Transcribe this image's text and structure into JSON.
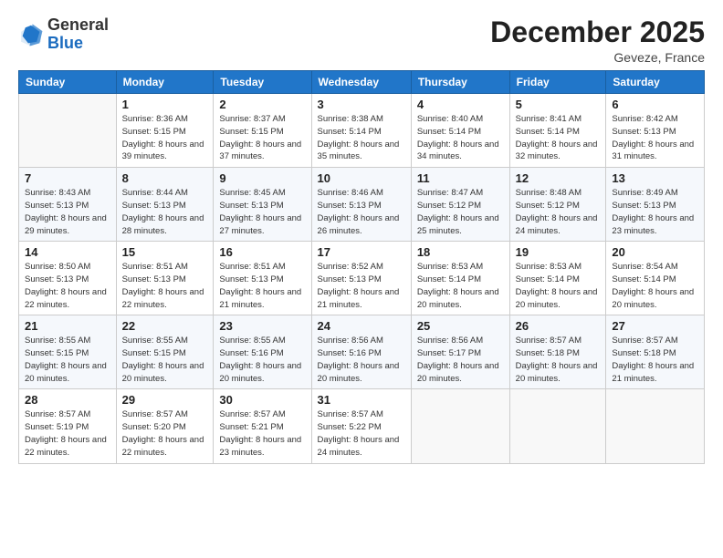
{
  "logo": {
    "general": "General",
    "blue": "Blue"
  },
  "header": {
    "title": "December 2025",
    "subtitle": "Geveze, France"
  },
  "weekdays": [
    "Sunday",
    "Monday",
    "Tuesday",
    "Wednesday",
    "Thursday",
    "Friday",
    "Saturday"
  ],
  "weeks": [
    [
      {
        "day": "",
        "empty": true
      },
      {
        "day": "1",
        "sunrise": "Sunrise: 8:36 AM",
        "sunset": "Sunset: 5:15 PM",
        "daylight": "Daylight: 8 hours and 39 minutes."
      },
      {
        "day": "2",
        "sunrise": "Sunrise: 8:37 AM",
        "sunset": "Sunset: 5:15 PM",
        "daylight": "Daylight: 8 hours and 37 minutes."
      },
      {
        "day": "3",
        "sunrise": "Sunrise: 8:38 AM",
        "sunset": "Sunset: 5:14 PM",
        "daylight": "Daylight: 8 hours and 35 minutes."
      },
      {
        "day": "4",
        "sunrise": "Sunrise: 8:40 AM",
        "sunset": "Sunset: 5:14 PM",
        "daylight": "Daylight: 8 hours and 34 minutes."
      },
      {
        "day": "5",
        "sunrise": "Sunrise: 8:41 AM",
        "sunset": "Sunset: 5:14 PM",
        "daylight": "Daylight: 8 hours and 32 minutes."
      },
      {
        "day": "6",
        "sunrise": "Sunrise: 8:42 AM",
        "sunset": "Sunset: 5:13 PM",
        "daylight": "Daylight: 8 hours and 31 minutes."
      }
    ],
    [
      {
        "day": "7",
        "sunrise": "Sunrise: 8:43 AM",
        "sunset": "Sunset: 5:13 PM",
        "daylight": "Daylight: 8 hours and 29 minutes."
      },
      {
        "day": "8",
        "sunrise": "Sunrise: 8:44 AM",
        "sunset": "Sunset: 5:13 PM",
        "daylight": "Daylight: 8 hours and 28 minutes."
      },
      {
        "day": "9",
        "sunrise": "Sunrise: 8:45 AM",
        "sunset": "Sunset: 5:13 PM",
        "daylight": "Daylight: 8 hours and 27 minutes."
      },
      {
        "day": "10",
        "sunrise": "Sunrise: 8:46 AM",
        "sunset": "Sunset: 5:13 PM",
        "daylight": "Daylight: 8 hours and 26 minutes."
      },
      {
        "day": "11",
        "sunrise": "Sunrise: 8:47 AM",
        "sunset": "Sunset: 5:12 PM",
        "daylight": "Daylight: 8 hours and 25 minutes."
      },
      {
        "day": "12",
        "sunrise": "Sunrise: 8:48 AM",
        "sunset": "Sunset: 5:12 PM",
        "daylight": "Daylight: 8 hours and 24 minutes."
      },
      {
        "day": "13",
        "sunrise": "Sunrise: 8:49 AM",
        "sunset": "Sunset: 5:13 PM",
        "daylight": "Daylight: 8 hours and 23 minutes."
      }
    ],
    [
      {
        "day": "14",
        "sunrise": "Sunrise: 8:50 AM",
        "sunset": "Sunset: 5:13 PM",
        "daylight": "Daylight: 8 hours and 22 minutes."
      },
      {
        "day": "15",
        "sunrise": "Sunrise: 8:51 AM",
        "sunset": "Sunset: 5:13 PM",
        "daylight": "Daylight: 8 hours and 22 minutes."
      },
      {
        "day": "16",
        "sunrise": "Sunrise: 8:51 AM",
        "sunset": "Sunset: 5:13 PM",
        "daylight": "Daylight: 8 hours and 21 minutes."
      },
      {
        "day": "17",
        "sunrise": "Sunrise: 8:52 AM",
        "sunset": "Sunset: 5:13 PM",
        "daylight": "Daylight: 8 hours and 21 minutes."
      },
      {
        "day": "18",
        "sunrise": "Sunrise: 8:53 AM",
        "sunset": "Sunset: 5:14 PM",
        "daylight": "Daylight: 8 hours and 20 minutes."
      },
      {
        "day": "19",
        "sunrise": "Sunrise: 8:53 AM",
        "sunset": "Sunset: 5:14 PM",
        "daylight": "Daylight: 8 hours and 20 minutes."
      },
      {
        "day": "20",
        "sunrise": "Sunrise: 8:54 AM",
        "sunset": "Sunset: 5:14 PM",
        "daylight": "Daylight: 8 hours and 20 minutes."
      }
    ],
    [
      {
        "day": "21",
        "sunrise": "Sunrise: 8:55 AM",
        "sunset": "Sunset: 5:15 PM",
        "daylight": "Daylight: 8 hours and 20 minutes."
      },
      {
        "day": "22",
        "sunrise": "Sunrise: 8:55 AM",
        "sunset": "Sunset: 5:15 PM",
        "daylight": "Daylight: 8 hours and 20 minutes."
      },
      {
        "day": "23",
        "sunrise": "Sunrise: 8:55 AM",
        "sunset": "Sunset: 5:16 PM",
        "daylight": "Daylight: 8 hours and 20 minutes."
      },
      {
        "day": "24",
        "sunrise": "Sunrise: 8:56 AM",
        "sunset": "Sunset: 5:16 PM",
        "daylight": "Daylight: 8 hours and 20 minutes."
      },
      {
        "day": "25",
        "sunrise": "Sunrise: 8:56 AM",
        "sunset": "Sunset: 5:17 PM",
        "daylight": "Daylight: 8 hours and 20 minutes."
      },
      {
        "day": "26",
        "sunrise": "Sunrise: 8:57 AM",
        "sunset": "Sunset: 5:18 PM",
        "daylight": "Daylight: 8 hours and 20 minutes."
      },
      {
        "day": "27",
        "sunrise": "Sunrise: 8:57 AM",
        "sunset": "Sunset: 5:18 PM",
        "daylight": "Daylight: 8 hours and 21 minutes."
      }
    ],
    [
      {
        "day": "28",
        "sunrise": "Sunrise: 8:57 AM",
        "sunset": "Sunset: 5:19 PM",
        "daylight": "Daylight: 8 hours and 22 minutes."
      },
      {
        "day": "29",
        "sunrise": "Sunrise: 8:57 AM",
        "sunset": "Sunset: 5:20 PM",
        "daylight": "Daylight: 8 hours and 22 minutes."
      },
      {
        "day": "30",
        "sunrise": "Sunrise: 8:57 AM",
        "sunset": "Sunset: 5:21 PM",
        "daylight": "Daylight: 8 hours and 23 minutes."
      },
      {
        "day": "31",
        "sunrise": "Sunrise: 8:57 AM",
        "sunset": "Sunset: 5:22 PM",
        "daylight": "Daylight: 8 hours and 24 minutes."
      },
      {
        "day": "",
        "empty": true
      },
      {
        "day": "",
        "empty": true
      },
      {
        "day": "",
        "empty": true
      }
    ]
  ]
}
